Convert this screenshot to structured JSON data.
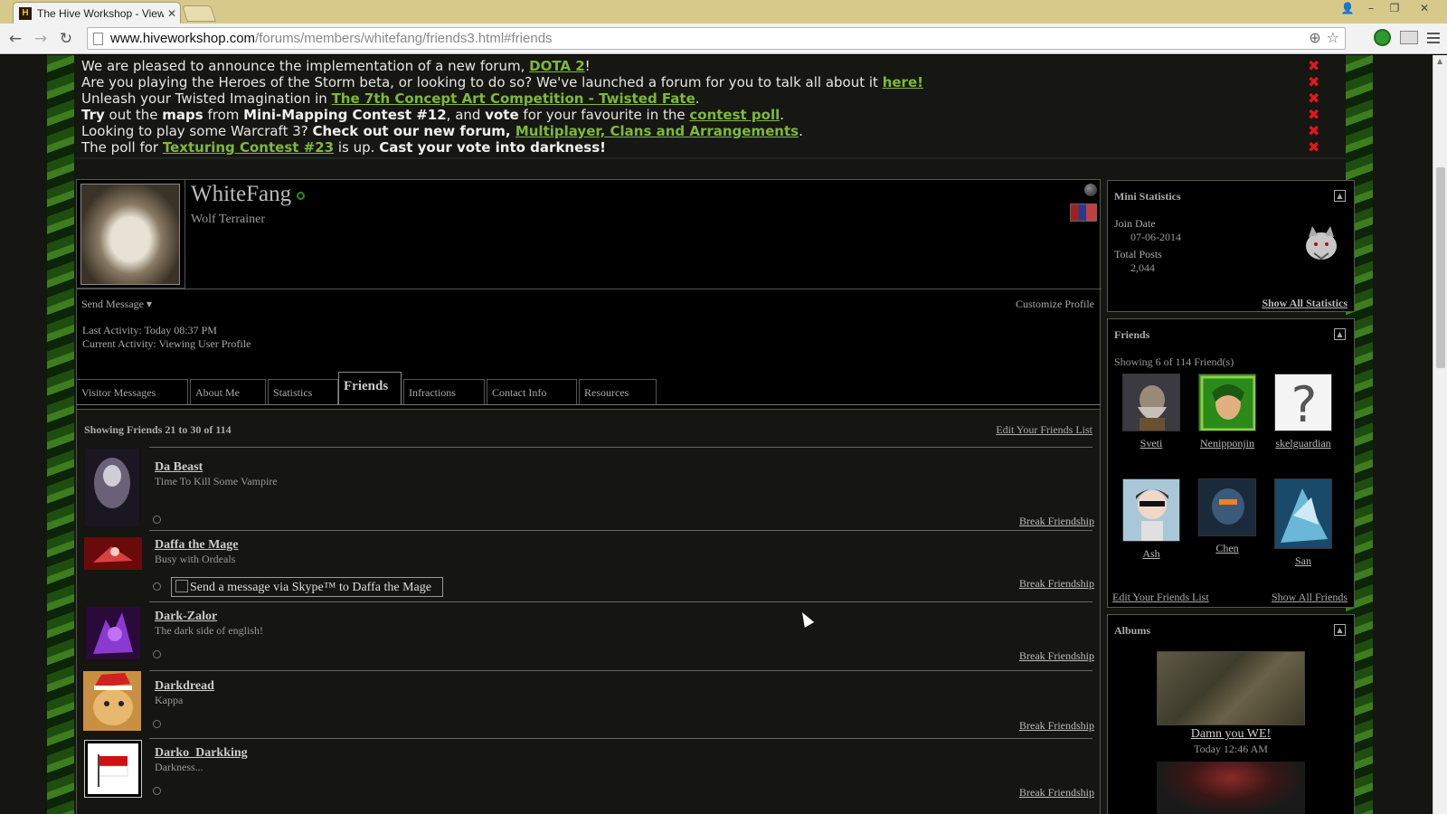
{
  "browser": {
    "tab_title": "The Hive Workshop - View",
    "tab_favicon": "H",
    "url_host": "www.hiveworkshop.com",
    "url_path": "/forums/members/whitefang/friends3.html#friends"
  },
  "announcements": [
    {
      "segments": [
        {
          "t": "We are pleased to announce the implementation of a new forum, "
        },
        {
          "t": "DOTA 2",
          "link": true
        },
        {
          "t": "!"
        }
      ]
    },
    {
      "segments": [
        {
          "t": "Are you playing the Heroes of the Storm beta, or looking to do so? We've launched a forum for you to talk all about it "
        },
        {
          "t": "here!",
          "link": true
        }
      ]
    },
    {
      "segments": [
        {
          "t": "Unleash your Twisted Imagination in "
        },
        {
          "t": "The 7th Concept Art Competition - Twisted Fate",
          "link": true
        },
        {
          "t": "."
        }
      ]
    },
    {
      "segments": [
        {
          "t": "Try",
          "bold": true
        },
        {
          "t": " out the "
        },
        {
          "t": "maps",
          "bold": true
        },
        {
          "t": " from "
        },
        {
          "t": "Mini-Mapping Contest #12",
          "bold": true
        },
        {
          "t": ", and "
        },
        {
          "t": "vote",
          "bold": true
        },
        {
          "t": " for your favourite in the "
        },
        {
          "t": "contest poll",
          "link": true
        },
        {
          "t": "."
        }
      ]
    },
    {
      "segments": [
        {
          "t": "Looking to play some Warcraft 3? "
        },
        {
          "t": "Check out our new forum, ",
          "bold": true
        },
        {
          "t": "Multiplayer, Clans and Arrangements",
          "link": true
        },
        {
          "t": "."
        }
      ]
    },
    {
      "segments": [
        {
          "t": "The poll for "
        },
        {
          "t": "Texturing Contest #23",
          "link": true
        },
        {
          "t": " is up. "
        },
        {
          "t": "Cast your vote into darkness!",
          "bold": true
        }
      ]
    }
  ],
  "profile": {
    "username": "WhiteFang",
    "usertitle": "Wolf Terrainer",
    "send_message": "Send Message",
    "customize": "Customize Profile",
    "last_activity": "Last Activity: Today 08:37 PM",
    "current_activity": "Current Activity: Viewing User Profile"
  },
  "tabs": [
    "Visitor Messages",
    "About Me",
    "Statistics",
    "Friends",
    "Infractions",
    "Contact Info",
    "Resources"
  ],
  "friends_list": {
    "heading": "Showing Friends 21 to 30 of 114",
    "edit_link": "Edit Your Friends List",
    "break_label": "Break Friendship",
    "skype_text": "Send a message via Skype™ to Daffa the Mage",
    "items": [
      {
        "name": "Da Beast",
        "status": "Time To Kill Some Vampire"
      },
      {
        "name": "Daffa the Mage",
        "status": "Busy with Ordeals"
      },
      {
        "name": "Dark-Zalor",
        "status": "The dark side of english!"
      },
      {
        "name": "Darkdread",
        "status": "Kappa"
      },
      {
        "name": "Darko_Darkking",
        "status": "Darkness..."
      }
    ]
  },
  "sidebar": {
    "mini_stats": {
      "title": "Mini Statistics",
      "join_label": "Join Date",
      "join_value": "07-06-2014",
      "posts_label": "Total Posts",
      "posts_value": "2,044",
      "show_all": "Show All Statistics"
    },
    "friends": {
      "title": "Friends",
      "showing": "Showing 6 of 114 Friend(s)",
      "items": [
        "Sveti",
        "Nenipponjin",
        "skelguardian",
        "Ash",
        "Chen",
        "San"
      ],
      "edit_link": "Edit Your Friends List",
      "show_all": "Show All Friends"
    },
    "albums": {
      "title": "Albums",
      "caption": "Damn you WE!",
      "time": "Today 12:46 AM"
    }
  },
  "colors": {
    "link_green": "#7fb83a",
    "close_red": "#e01818",
    "background": "#000000"
  }
}
